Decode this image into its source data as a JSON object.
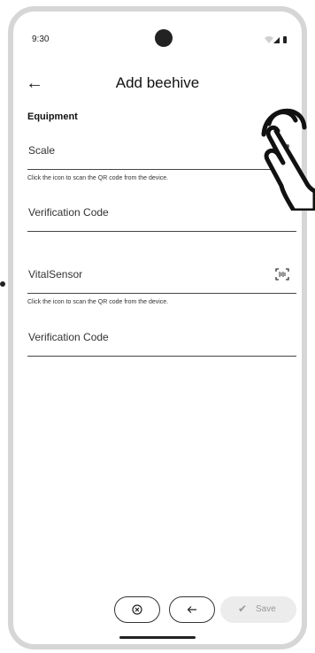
{
  "status_bar": {
    "time": "9:30"
  },
  "app_bar": {
    "title": "Add beehive"
  },
  "section_label": "Equipment",
  "scale": {
    "label": "Scale",
    "helper": "Click the icon to scan the QR code from the device.",
    "verification_label": "Verification Code"
  },
  "vital": {
    "label": "VitalSensor",
    "helper": "Click the icon to scan the QR code from the device.",
    "verification_label": "Verification Code"
  },
  "bottom_bar": {
    "save_label": "Save"
  },
  "icons": {
    "back": "arrow-left-icon",
    "qr": "qr-scan-icon",
    "cancel": "cancel-circle-icon",
    "previous": "arrow-left-icon",
    "save": "check-icon",
    "gesture": "tap-hand-icon"
  }
}
